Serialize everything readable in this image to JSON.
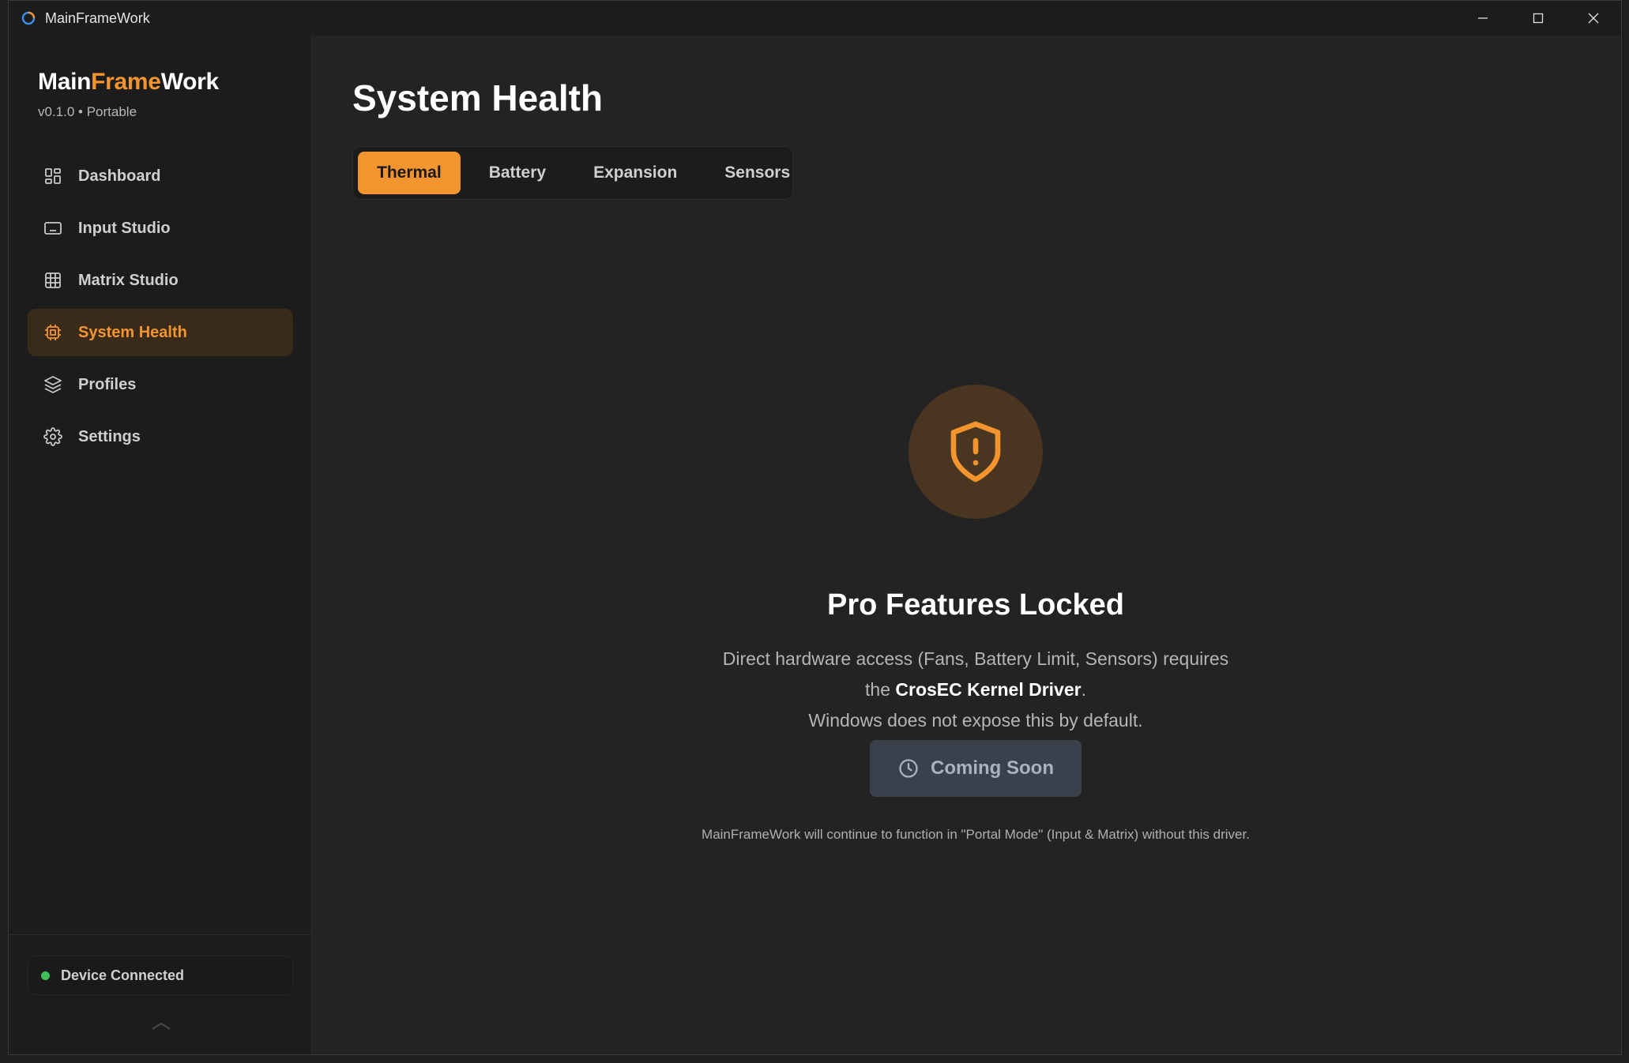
{
  "window": {
    "title": "MainFrameWork"
  },
  "sidebar": {
    "brand_part1": "Main",
    "brand_part2": "Frame",
    "brand_part3": "Work",
    "version": "v0.1.0 • Portable",
    "items": [
      {
        "label": "Dashboard",
        "icon": "dashboard-icon",
        "active": false
      },
      {
        "label": "Input Studio",
        "icon": "keyboard-icon",
        "active": false
      },
      {
        "label": "Matrix Studio",
        "icon": "grid-icon",
        "active": false
      },
      {
        "label": "System Health",
        "icon": "chip-icon",
        "active": true
      },
      {
        "label": "Profiles",
        "icon": "layers-icon",
        "active": false
      },
      {
        "label": "Settings",
        "icon": "gear-icon",
        "active": false
      }
    ],
    "device_status": "Device Connected",
    "device_status_color": "#3fbf5b"
  },
  "main": {
    "title": "System Health",
    "tabs": [
      {
        "label": "Thermal",
        "active": true
      },
      {
        "label": "Battery",
        "active": false
      },
      {
        "label": "Expansion",
        "active": false
      },
      {
        "label": "Sensors",
        "active": false
      }
    ],
    "locked": {
      "icon": "shield-alert-icon",
      "title": "Pro Features Locked",
      "desc_line1": "Direct hardware access (Fans, Battery Limit, Sensors) requires",
      "desc_line2_pre": "the ",
      "desc_line2_strong": "CrosEC Kernel Driver",
      "desc_line2_post": ".",
      "desc_line3": "Windows does not expose this by default.",
      "button_label": "Coming Soon",
      "button_icon": "clock-icon",
      "footnote": "MainFrameWork will continue to function in \"Portal Mode\" (Input & Matrix) without this driver."
    }
  },
  "colors": {
    "accent": "#f2952f",
    "background": "#232323",
    "sidebar": "#1c1c1c"
  }
}
